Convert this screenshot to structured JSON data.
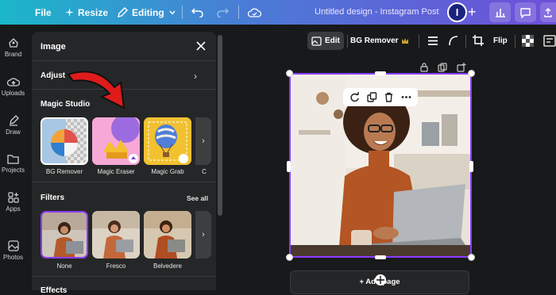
{
  "topbar": {
    "file": "File",
    "resize": "Resize",
    "mode": "Editing",
    "doc_title": "Untitled design - Instagram Post",
    "avatar_initial": "I"
  },
  "rail": {
    "items": [
      {
        "label": "Brand",
        "icon": "brand-icon"
      },
      {
        "label": "Uploads",
        "icon": "upload-cloud-icon"
      },
      {
        "label": "Draw",
        "icon": "pen-icon"
      },
      {
        "label": "Projects",
        "icon": "folder-icon"
      },
      {
        "label": "Apps",
        "icon": "apps-icon"
      },
      {
        "label": "Photos",
        "icon": "photo-icon"
      }
    ]
  },
  "panel": {
    "title": "Image",
    "adjust": "Adjust",
    "magic_studio": "Magic Studio",
    "magic_tools": [
      {
        "label": "BG Remover"
      },
      {
        "label": "Magic Eraser"
      },
      {
        "label": "Magic Grab"
      },
      {
        "label": "C"
      }
    ],
    "filters_label": "Filters",
    "see_all": "See all",
    "filters": [
      {
        "label": "None"
      },
      {
        "label": "Fresco"
      },
      {
        "label": "Belvedere"
      }
    ],
    "effects_label": "Effects"
  },
  "toolbar": {
    "edit": "Edit",
    "bg_remover": "BG Remover",
    "flip": "Flip"
  },
  "canvas": {
    "add_page": "+ Add page"
  },
  "colors": {
    "accent_purple": "#8b3dff",
    "arrow_red": "#e01b1b"
  }
}
